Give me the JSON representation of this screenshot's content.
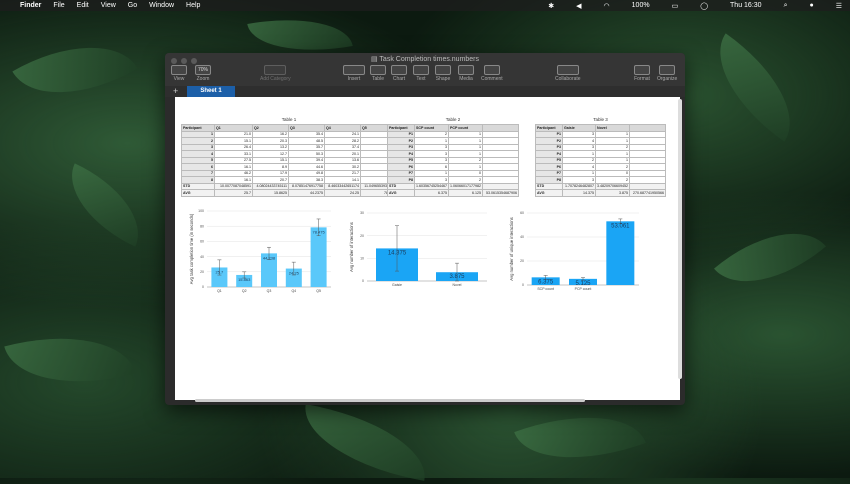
{
  "menubar": {
    "items": [
      "Finder",
      "File",
      "Edit",
      "View",
      "Go",
      "Window",
      "Help"
    ],
    "battery": "100%",
    "datetime": "Thu 16:30"
  },
  "window": {
    "title": "Task Completion times.numbers",
    "toolbar": {
      "view": "View",
      "zoom_value": "70%",
      "zoom": "Zoom",
      "add_category": "Add Category",
      "insert": "Insert",
      "table": "Table",
      "chart": "Chart",
      "text": "Text",
      "shape": "Shape",
      "media": "Media",
      "comment": "Comment",
      "collaborate": "Collaborate",
      "format": "Format",
      "organize": "Organize"
    },
    "sheet_tab": "Sheet 1"
  },
  "table1": {
    "caption": "Table 1",
    "headers": [
      "Participant",
      "Q1",
      "Q2",
      "Q3",
      "Q4",
      "Q5"
    ],
    "rows": [
      [
        "1",
        "21.0",
        "16.2",
        "35.4",
        "24.1",
        "72.4"
      ],
      [
        "2",
        "15.1",
        "20.3",
        "48.5",
        "28.2",
        "63.1"
      ],
      [
        "3",
        "26.4",
        "13.2",
        "35.7",
        "37.4",
        "86.0"
      ],
      [
        "4",
        "33.1",
        "12.7",
        "50.3",
        "20.1",
        "84.4"
      ],
      [
        "5",
        "27.5",
        "15.1",
        "39.4",
        "13.6",
        "90.7"
      ],
      [
        "6",
        "16.1",
        "8.9",
        "44.6",
        "30.2",
        "80.1"
      ],
      [
        "7",
        "46.2",
        "17.9",
        "49.8",
        "21.7",
        "76.3"
      ],
      [
        "8",
        "16.1",
        "20.7",
        "38.3",
        "14.1",
        "80.8"
      ]
    ],
    "std": [
      "STD",
      "10.0077087048591",
      "4.08024433745111",
      "8.07851476917758",
      "8.46033442651174",
      "11.0496553936062"
    ],
    "avg": [
      "AVG",
      "25.7",
      "15.8625",
      "44.2375",
      "24.25",
      "78.475"
    ]
  },
  "table2": {
    "caption": "Table 2",
    "headers": [
      "Participant",
      "SCP count",
      "PCP count"
    ],
    "rows": [
      [
        "P1",
        "2",
        "1"
      ],
      [
        "P2",
        "1",
        "1"
      ],
      [
        "P3",
        "3",
        "1"
      ],
      [
        "P4",
        "3",
        "1"
      ],
      [
        "P5",
        "3",
        "2"
      ],
      [
        "P6",
        "6",
        "1"
      ],
      [
        "P7",
        "1",
        "0"
      ],
      [
        "P8",
        "3",
        "2"
      ]
    ],
    "std": [
      "STD",
      "1.60356745254467",
      "1.06066017177982"
    ],
    "avg": [
      "AVG",
      "6.375",
      "6.125",
      "53.0615354687906"
    ]
  },
  "table3": {
    "caption": "Table 3",
    "headers": [
      "Participant",
      "Gaisie",
      "Novel"
    ],
    "rows": [
      [
        "P1",
        "3",
        "1"
      ],
      [
        "P2",
        "4",
        "1"
      ],
      [
        "P3",
        "3",
        "2"
      ],
      [
        "P4",
        "1",
        "1"
      ],
      [
        "P5",
        "2",
        "1"
      ],
      [
        "P6",
        "4",
        "2"
      ],
      [
        "P7",
        "1",
        "0"
      ],
      [
        "P8",
        "3",
        "2"
      ]
    ],
    "std": [
      "STD",
      "1.7078246482807",
      "3.48209706609452"
    ],
    "avg": [
      "AVG",
      "14.375",
      "3.875",
      "270.687741950566"
    ]
  },
  "chart_data": [
    {
      "type": "bar",
      "categories": [
        "Q1",
        "Q2",
        "Q3",
        "Q4",
        "Q5"
      ],
      "values": [
        25.7,
        15.863,
        44.238,
        24.25,
        78.475
      ],
      "data_labels": [
        "25.7",
        "15.863",
        "44.238",
        "24.25",
        "78.475"
      ],
      "errors": [
        10.0,
        4.08,
        8.08,
        8.46,
        11.05
      ],
      "ylabel": "Avg task completion time (in seconds)",
      "ylim": [
        0,
        100
      ],
      "yticks": [
        "0",
        "20",
        "40",
        "60",
        "80",
        "100"
      ],
      "color": "#5ac8fa"
    },
    {
      "type": "bar",
      "categories": [
        "Gaisie",
        "Novel"
      ],
      "values": [
        14.375,
        3.875
      ],
      "data_labels": [
        "14.375",
        "3.875"
      ],
      "errors": [
        10.0,
        4.0
      ],
      "ylabel": "Avg number of interactions",
      "ylim": [
        0,
        30
      ],
      "yticks": [
        "0",
        "10",
        "20",
        "30"
      ],
      "color": "#1aa5f5"
    },
    {
      "type": "bar",
      "categories": [
        "SCP count",
        "PCP count",
        "Unique"
      ],
      "values": [
        6.375,
        5.125,
        53.061
      ],
      "data_labels": [
        "6.375",
        "5.125",
        "53.061"
      ],
      "errors": [
        1.6,
        1.06,
        2.0
      ],
      "ylabel": "Avg number of unique interactions",
      "ylim": [
        0,
        60
      ],
      "yticks": [
        "0",
        "20",
        "40",
        "60"
      ],
      "color": "#1aa5f5"
    }
  ]
}
